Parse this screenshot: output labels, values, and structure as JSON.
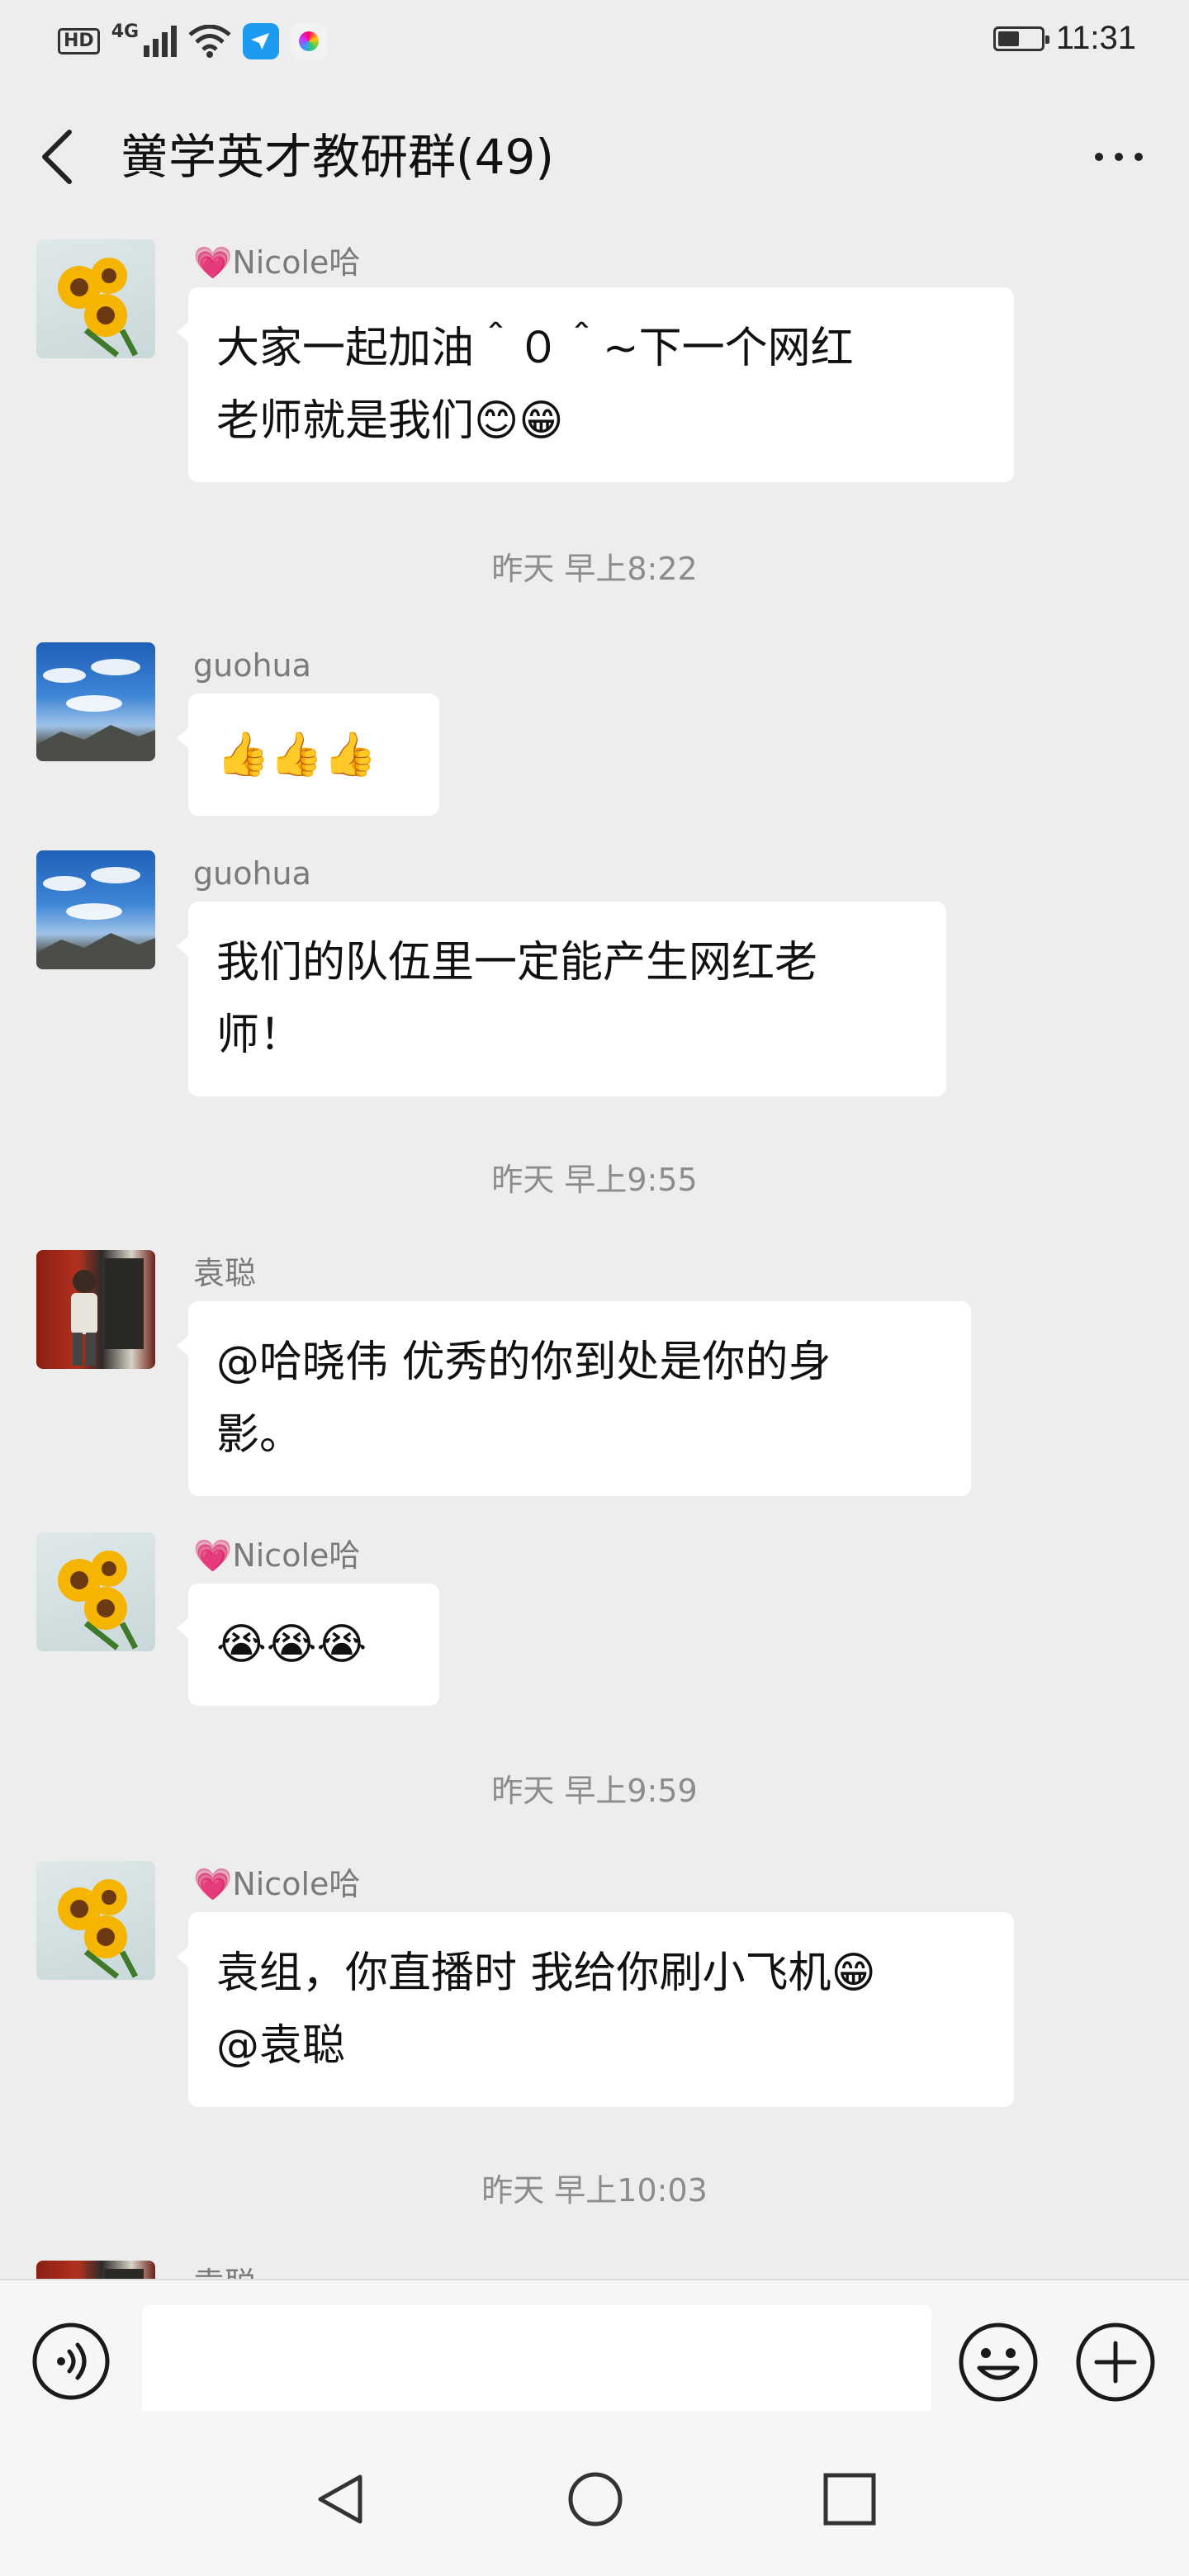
{
  "status_bar": {
    "network": "4G",
    "hd_label": "HD",
    "time": "11:31",
    "battery_level": 0.5,
    "icons": [
      "signal-icon",
      "wifi-icon",
      "app-notification-icon",
      "gallery-app-icon",
      "battery-icon"
    ]
  },
  "header": {
    "title": "黉学英才教研群(49)",
    "back_icon": "chevron-left-icon",
    "more_icon": "more-dots-icon"
  },
  "messages": [
    {
      "sender": "💗Nicole哈",
      "avatar": "sunflower",
      "text_lines": [
        "大家一起加油＾０＾~下一个网红",
        "老师就是我们😊😁"
      ]
    },
    {
      "timestamp": "昨天 早上8:22"
    },
    {
      "sender": "guohua",
      "avatar": "sky-mountain",
      "text_lines": [
        "👍👍👍"
      ]
    },
    {
      "sender": "guohua",
      "avatar": "sky-mountain",
      "text_lines": [
        "我们的队伍里一定能产生网红老",
        "师！"
      ]
    },
    {
      "timestamp": "昨天 早上9:55"
    },
    {
      "sender": "袁聪",
      "avatar": "red-wall-person",
      "text_lines": [
        "@哈晓伟  优秀的你到处是你的身",
        "影。"
      ]
    },
    {
      "sender": "💗Nicole哈",
      "avatar": "sunflower",
      "text_lines": [
        "😭😭😭"
      ]
    },
    {
      "timestamp": "昨天 早上9:59"
    },
    {
      "sender": "💗Nicole哈",
      "avatar": "sunflower",
      "text_lines": [
        "袁组，你直播时 我给你刷小飞机😁",
        "@袁聪"
      ]
    },
    {
      "timestamp": "昨天 早上10:03"
    },
    {
      "sender": "袁聪",
      "avatar": "red-wall-person",
      "text_lines": []
    }
  ],
  "input_bar": {
    "voice_icon": "voice-input-icon",
    "emoji_icon": "emoji-icon",
    "plus_icon": "plus-icon",
    "value": ""
  },
  "nav_bar": {
    "icons": [
      "nav-back-icon",
      "nav-home-icon",
      "nav-recents-icon"
    ]
  }
}
